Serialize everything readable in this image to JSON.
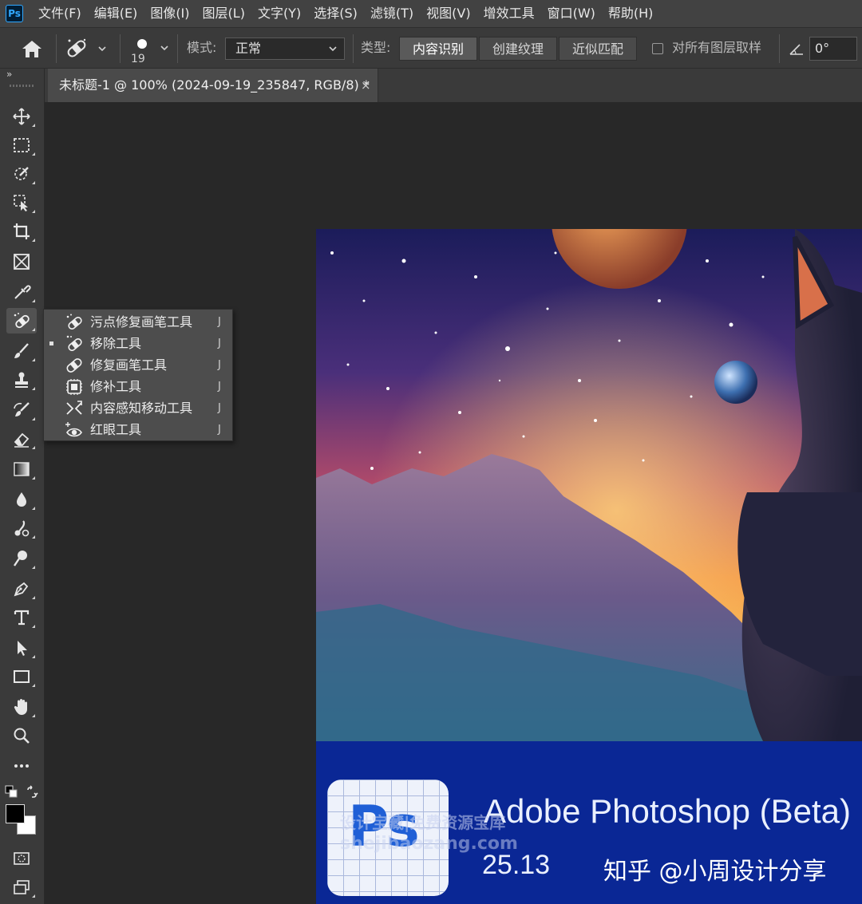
{
  "app": {
    "logo_text": "Ps"
  },
  "menubar": {
    "items": [
      "文件(F)",
      "编辑(E)",
      "图像(I)",
      "图层(L)",
      "文字(Y)",
      "选择(S)",
      "滤镜(T)",
      "视图(V)",
      "增效工具",
      "窗口(W)",
      "帮助(H)"
    ]
  },
  "options": {
    "brush_size": "19",
    "mode_label": "模式:",
    "mode_value": "正常",
    "type_label": "类型:",
    "type_buttons": [
      "内容识别",
      "创建纹理",
      "近似匹配"
    ],
    "sample_all_label": "对所有图层取样",
    "sample_all_checked": false,
    "angle_value": "0°"
  },
  "toolbar": {
    "collapse_glyph": "»",
    "tools": [
      "move-icon",
      "marquee-icon",
      "quick-select-icon",
      "object-select-icon",
      "crop-icon",
      "frame-icon",
      "eyedropper-icon",
      "spot-healing-icon",
      "brush-icon",
      "clone-stamp-icon",
      "history-brush-icon",
      "eraser-icon",
      "gradient-icon",
      "blur-icon",
      "smudge-icon",
      "dodge-icon",
      "pen-icon",
      "type-icon",
      "path-select-icon",
      "rectangle-icon",
      "hand-icon",
      "zoom-icon",
      "more-tools-icon"
    ],
    "foreground_color": "#000000",
    "background_color": "#ffffff"
  },
  "document": {
    "tab_title": "未标题-1 @ 100% (2024-09-19_235847, RGB/8) *",
    "close_glyph": "×"
  },
  "flyout": {
    "items": [
      {
        "label": "污点修复画笔工具",
        "key": "J",
        "selected": false,
        "icon": "spot-healing-brush-icon"
      },
      {
        "label": "移除工具",
        "key": "J",
        "selected": true,
        "icon": "remove-tool-icon"
      },
      {
        "label": "修复画笔工具",
        "key": "J",
        "selected": false,
        "icon": "healing-brush-icon"
      },
      {
        "label": "修补工具",
        "key": "J",
        "selected": false,
        "icon": "patch-tool-icon"
      },
      {
        "label": "内容感知移动工具",
        "key": "J",
        "selected": false,
        "icon": "content-aware-move-icon"
      },
      {
        "label": "红眼工具",
        "key": "J",
        "selected": false,
        "icon": "red-eye-icon"
      }
    ]
  },
  "splash": {
    "product_name": "Adobe Photoshop (Beta)",
    "version": "25.13",
    "icon_letters": "Ps",
    "watermark_line1": "设计宝藏|免费资源宝库",
    "watermark_line2": "shejibaozang.com",
    "credit": "知乎 @小周设计分享",
    "footer_color": "#0a2795"
  }
}
